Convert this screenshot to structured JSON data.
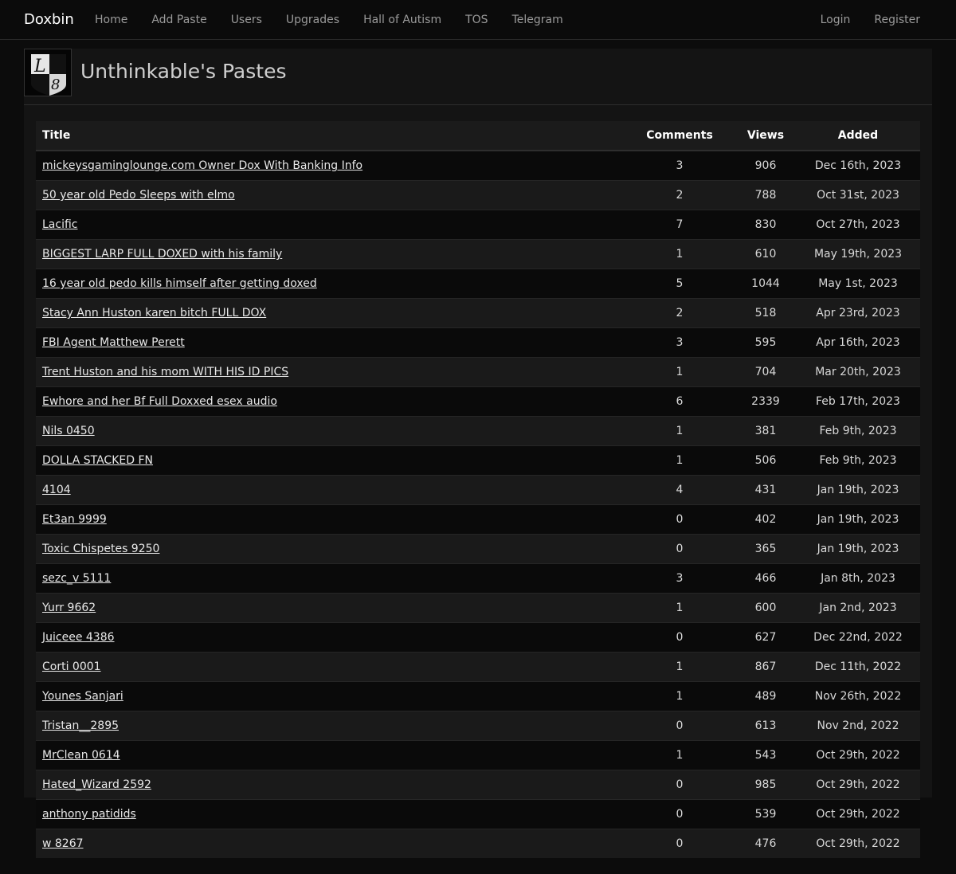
{
  "nav": {
    "brand": "Doxbin",
    "links": [
      "Home",
      "Add Paste",
      "Users",
      "Upgrades",
      "Hall of Autism",
      "TOS",
      "Telegram"
    ],
    "right_links": [
      "Login",
      "Register"
    ]
  },
  "profile": {
    "title": "Unthinkable's Pastes"
  },
  "table": {
    "headers": {
      "title": "Title",
      "comments": "Comments",
      "views": "Views",
      "added": "Added"
    },
    "rows": [
      {
        "title": "mickeysgaminglounge.com Owner Dox With Banking Info",
        "comments": "3",
        "views": "906",
        "added": "Dec 16th, 2023"
      },
      {
        "title": "50 year old Pedo Sleeps with elmo",
        "comments": "2",
        "views": "788",
        "added": "Oct 31st, 2023"
      },
      {
        "title": "Lacific",
        "comments": "7",
        "views": "830",
        "added": "Oct 27th, 2023"
      },
      {
        "title": "BIGGEST LARP FULL DOXED with his family",
        "comments": "1",
        "views": "610",
        "added": "May 19th, 2023"
      },
      {
        "title": "16 year old pedo kills himself after getting doxed",
        "comments": "5",
        "views": "1044",
        "added": "May 1st, 2023"
      },
      {
        "title": "Stacy Ann Huston karen bitch FULL DOX",
        "comments": "2",
        "views": "518",
        "added": "Apr 23rd, 2023"
      },
      {
        "title": "FBI Agent Matthew Perett",
        "comments": "3",
        "views": "595",
        "added": "Apr 16th, 2023"
      },
      {
        "title": "Trent Huston and his mom WITH HIS ID PICS",
        "comments": "1",
        "views": "704",
        "added": "Mar 20th, 2023"
      },
      {
        "title": "Ewhore and her Bf Full Doxxed esex audio",
        "comments": "6",
        "views": "2339",
        "added": "Feb 17th, 2023"
      },
      {
        "title": "Nils 0450",
        "comments": "1",
        "views": "381",
        "added": "Feb 9th, 2023"
      },
      {
        "title": "DOLLA STACKED FN",
        "comments": "1",
        "views": "506",
        "added": "Feb 9th, 2023"
      },
      {
        "title": "4104",
        "comments": "4",
        "views": "431",
        "added": "Jan 19th, 2023"
      },
      {
        "title": "Et3an 9999",
        "comments": "0",
        "views": "402",
        "added": "Jan 19th, 2023"
      },
      {
        "title": "Toxic Chispetes 9250",
        "comments": "0",
        "views": "365",
        "added": "Jan 19th, 2023"
      },
      {
        "title": "sezc_v 5111",
        "comments": "3",
        "views": "466",
        "added": "Jan 8th, 2023"
      },
      {
        "title": "Yurr 9662",
        "comments": "1",
        "views": "600",
        "added": "Jan 2nd, 2023"
      },
      {
        "title": "Juiceee 4386",
        "comments": "0",
        "views": "627",
        "added": "Dec 22nd, 2022"
      },
      {
        "title": "Corti 0001",
        "comments": "1",
        "views": "867",
        "added": "Dec 11th, 2022"
      },
      {
        "title": "Younes Sanjari",
        "comments": "1",
        "views": "489",
        "added": "Nov 26th, 2022"
      },
      {
        "title": "Tristan__2895",
        "comments": "0",
        "views": "613",
        "added": "Nov 2nd, 2022"
      },
      {
        "title": "MrClean 0614",
        "comments": "1",
        "views": "543",
        "added": "Oct 29th, 2022"
      },
      {
        "title": "Hated_Wizard 2592",
        "comments": "0",
        "views": "985",
        "added": "Oct 29th, 2022"
      },
      {
        "title": "anthony patidids",
        "comments": "0",
        "views": "539",
        "added": "Oct 29th, 2022"
      },
      {
        "title": "w 8267",
        "comments": "0",
        "views": "476",
        "added": "Oct 29th, 2022"
      }
    ]
  }
}
